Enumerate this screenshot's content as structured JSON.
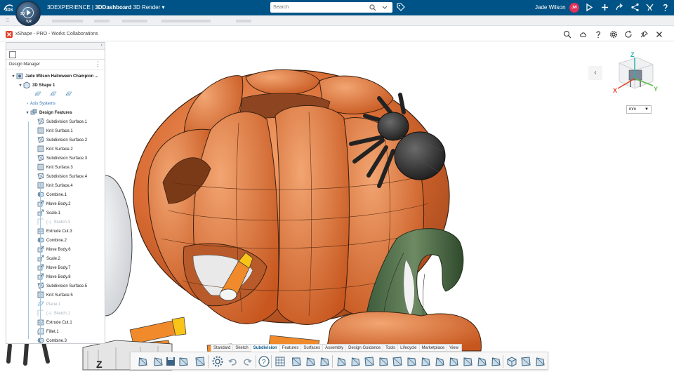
{
  "topbar": {
    "brand_prefix": "3DEXPERIENCE | ",
    "brand_app": "3DDashboard",
    "brand_suffix": " 3D Render",
    "search_placeholder": "Search",
    "user_name": "Jade Wilson",
    "user_initials": "JW",
    "compass_labels": {
      "top": "3D",
      "left": "V,R"
    }
  },
  "app": {
    "title": "xShape - PRO - Works Collaborations"
  },
  "tree": {
    "header": "Design Manager",
    "root": "Jade Wilson Halloween Champion ...",
    "shape": "3D Shape 1",
    "planes": [
      "XY",
      "YZ",
      "ZX"
    ],
    "axis_systems": "Axis Systems",
    "design_features": "Design Features",
    "features": [
      {
        "label": "Subdivision Surface.1",
        "icon": "subdivision-icon",
        "dim": false
      },
      {
        "label": "Knit Surface.1",
        "icon": "knit-surface-icon",
        "dim": false
      },
      {
        "label": "Subdivision Surface.2",
        "icon": "subdivision-icon",
        "dim": false
      },
      {
        "label": "Knit Surface.2",
        "icon": "knit-surface-icon",
        "dim": false
      },
      {
        "label": "Subdivision Surface.3",
        "icon": "subdivision-icon",
        "dim": false
      },
      {
        "label": "Knit Surface.3",
        "icon": "knit-surface-icon",
        "dim": false
      },
      {
        "label": "Subdivision Surface.4",
        "icon": "subdivision-icon",
        "dim": false
      },
      {
        "label": "Knit Surface.4",
        "icon": "knit-surface-icon",
        "dim": false
      },
      {
        "label": "Combine.1",
        "icon": "combine-icon",
        "dim": false
      },
      {
        "label": "Move Body.2",
        "icon": "move-body-icon",
        "dim": false
      },
      {
        "label": "Scale.1",
        "icon": "scale-icon",
        "dim": false
      },
      {
        "label": "Sketch.3",
        "icon": "sketch-icon",
        "dim": true
      },
      {
        "label": "Extrude Cut.3",
        "icon": "extrude-cut-icon",
        "dim": false
      },
      {
        "label": "Combine.2",
        "icon": "combine-icon",
        "dim": false
      },
      {
        "label": "Move Body.6",
        "icon": "move-body-icon",
        "dim": false
      },
      {
        "label": "Scale.2",
        "icon": "scale-icon",
        "dim": false
      },
      {
        "label": "Move Body.7",
        "icon": "move-body-icon",
        "dim": false
      },
      {
        "label": "Move Body.8",
        "icon": "move-body-icon",
        "dim": false
      },
      {
        "label": "Subdivision Surface.5",
        "icon": "subdivision-icon",
        "dim": false
      },
      {
        "label": "Knit Surface.5",
        "icon": "knit-surface-icon",
        "dim": false
      },
      {
        "label": "Plane.1",
        "icon": "plane-icon",
        "dim": true
      },
      {
        "label": "Sketch.1",
        "icon": "sketch-icon",
        "dim": true
      },
      {
        "label": "Extrude Cut.1",
        "icon": "extrude-cut-icon",
        "dim": false
      },
      {
        "label": "Fillet.1",
        "icon": "fillet-icon",
        "dim": false
      },
      {
        "label": "Combine.3",
        "icon": "combine-icon",
        "dim": false
      }
    ]
  },
  "viewport": {
    "units": "mm",
    "axes": {
      "x": "X",
      "y": "Y",
      "z": "Z"
    }
  },
  "action_tabs": [
    "Standard",
    "Sketch",
    "Subdivision",
    "Features",
    "Surfaces",
    "Assembly",
    "Design Guidance",
    "Tools",
    "Lifecycle",
    "Marketplace",
    "View"
  ],
  "active_action_tab": "Subdivision",
  "colors": {
    "topbar": "#005386",
    "pumpkin": "#d9733c",
    "spider": "#2a2a2a",
    "gourd": "#4e6b4a",
    "candy_orange": "#f08a2a",
    "candy_yellow": "#f7c417"
  }
}
